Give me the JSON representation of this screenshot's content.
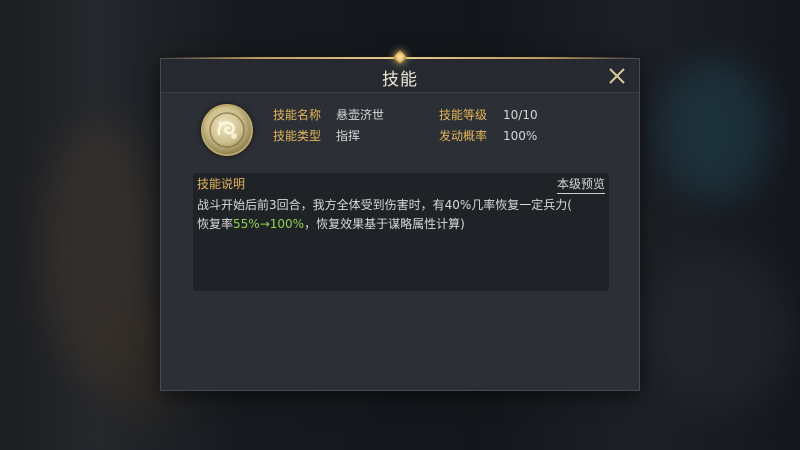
{
  "dialog": {
    "title": "技能",
    "close_icon": "close-icon"
  },
  "skill": {
    "icon": "skill-emblem-icon",
    "name_label": "技能名称",
    "name_value": "悬壶济世",
    "type_label": "技能类型",
    "type_value": "指挥",
    "level_label": "技能等级",
    "level_value": "10/10",
    "prob_label": "发动概率",
    "prob_value": "100%"
  },
  "description": {
    "title": "技能说明",
    "preview_label": "本级预览",
    "text_line1": "战斗开始后前3回合，我方全体受到伤害时，有40%几率恢复一定兵力(",
    "text_line2_pre": "恢复率",
    "text_line2_highlight": "55%→100%",
    "text_line2_post": "，恢复效果基于谋略属性计算)"
  },
  "colors": {
    "accent_gold": "#e2b55a",
    "highlight_green": "#8fd14f",
    "panel_bg": "#2c2f35"
  }
}
